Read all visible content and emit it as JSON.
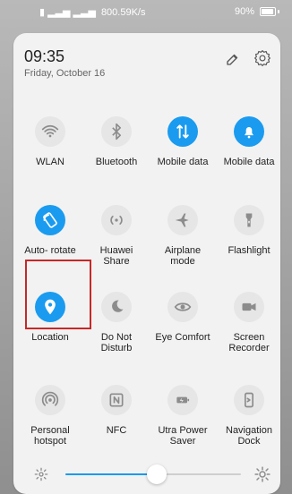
{
  "status_bar": {
    "speed": "800.59K/s",
    "battery": "90%"
  },
  "header": {
    "time": "09:35",
    "date": "Friday, October 16"
  },
  "tiles": [
    {
      "label": "WLAN",
      "icon": "wifi-icon",
      "active": false
    },
    {
      "label": "Bluetooth",
      "icon": "bluetooth-icon",
      "active": false
    },
    {
      "label": "Mobile data",
      "icon": "mobile-data-icon",
      "active": true
    },
    {
      "label": "Mobile data",
      "icon": "bell-icon",
      "active": true
    },
    {
      "label": "Auto- rotate",
      "icon": "rotate-icon",
      "active": true
    },
    {
      "label": "Huawei",
      "label2": "Share",
      "icon": "share-icon",
      "active": false
    },
    {
      "label": "Airplane",
      "label2": "mode",
      "icon": "airplane-icon",
      "active": false
    },
    {
      "label": "Flashlight",
      "icon": "flashlight-icon",
      "active": false
    },
    {
      "label": "Location",
      "icon": "location-icon",
      "active": true
    },
    {
      "label": "Do Not",
      "label2": "Disturb",
      "icon": "moon-icon",
      "active": false
    },
    {
      "label": "Eye Comfort",
      "icon": "eye-icon",
      "active": false
    },
    {
      "label": "Screen",
      "label2": "Recorder",
      "icon": "video-icon",
      "active": false
    },
    {
      "label": "Personal",
      "label2": "hotspot",
      "icon": "hotspot-icon",
      "active": false
    },
    {
      "label": "NFC",
      "icon": "nfc-icon",
      "active": false
    },
    {
      "label": "Utra Power",
      "label2": "Saver",
      "icon": "battery-saver-icon",
      "active": false
    },
    {
      "label": "Navigation",
      "label2": "Dock",
      "icon": "navigation-dock-icon",
      "active": false
    }
  ],
  "brightness": {
    "level": 0.52
  },
  "colors": {
    "accent": "#1a9bf0",
    "highlight": "#c62828"
  }
}
